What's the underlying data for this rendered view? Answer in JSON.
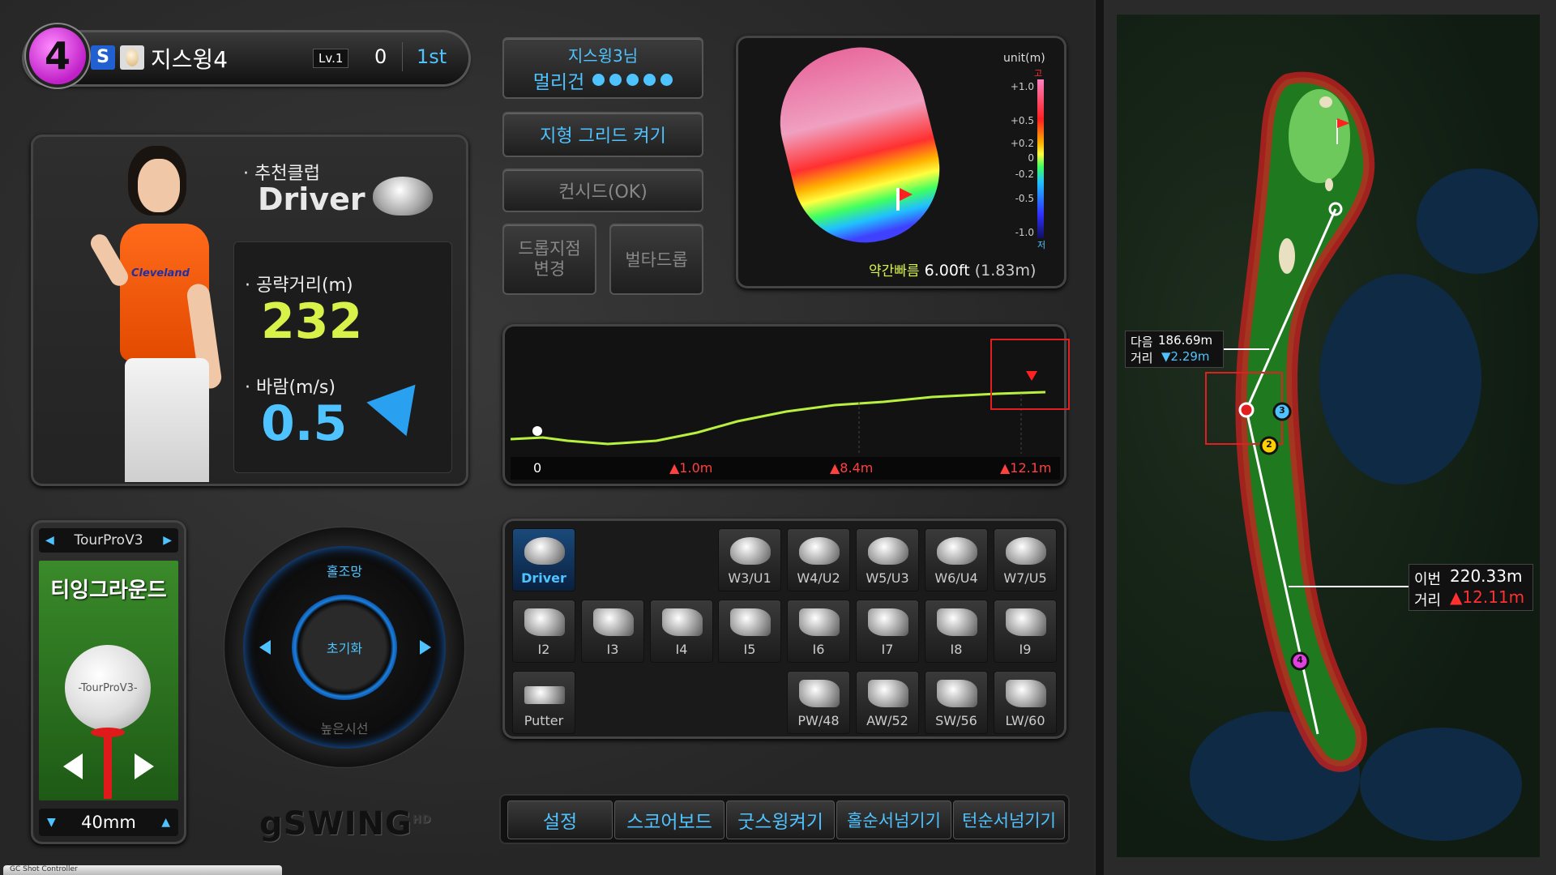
{
  "player": {
    "number": "4",
    "grade": "S",
    "name": "지스윙4",
    "level": "Lv.1",
    "score": "0",
    "rank": "1st"
  },
  "info": {
    "recommend_label": "· 추천클럽",
    "recommend_club": "Driver",
    "distance_label": "· 공략거리(m)",
    "distance_value": "232",
    "wind_label": "· 바람(m/s)",
    "wind_value": "0.5"
  },
  "top_buttons": {
    "player_line1": "지스윙3님",
    "player_line2": "멀리건",
    "terrain_grid": "지형 그리드 켜기",
    "concede": "컨시드(OK)",
    "drop_change": "드롭지점\n변경",
    "penalty_drop": "벌타드롭"
  },
  "green": {
    "unit": "unit(m)",
    "high": "고",
    "low": "저",
    "scale": [
      "+1.0",
      "+0.5",
      "+0.2",
      "0",
      "-0.2",
      "-0.5",
      "-1.0"
    ],
    "speed_label": "약간빠름",
    "speed_value": "6.00ft",
    "speed_meters": "(1.83m)"
  },
  "profile": {
    "ticks": [
      "0",
      "▲1.0m",
      "▲8.4m",
      "▲12.1m"
    ]
  },
  "ball_select": {
    "ball_name": "TourProV3",
    "ground": "티잉그라운드",
    "ball_print": "-TourProV3-",
    "tee_height": "40mm"
  },
  "dpad": {
    "up": "홀조망",
    "center": "초기화",
    "down": "높은시선"
  },
  "clubs": {
    "driver": "Driver",
    "woods": [
      "W3/U1",
      "W4/U2",
      "W5/U3",
      "W6/U4",
      "W7/U5"
    ],
    "irons": [
      "I2",
      "I3",
      "I4",
      "I5",
      "I6",
      "I7",
      "I8",
      "I9"
    ],
    "putter": "Putter",
    "wedges": [
      "PW/48",
      "AW/52",
      "SW/56",
      "LW/60"
    ]
  },
  "bottom_buttons": [
    "설정",
    "스코어보드",
    "굿스윙켜기",
    "홀순서넘기기",
    "턴순서넘기기"
  ],
  "logo": "gSWING",
  "logo_sup": "HD",
  "map": {
    "next_label1": "다음",
    "next_label2": "거리",
    "next_distance": "186.69m",
    "next_elev": "▼2.29m",
    "this_label1": "이번",
    "this_label2": "거리",
    "this_distance": "220.33m",
    "this_elev": "▲12.11m",
    "markers": [
      "3",
      "2",
      "4"
    ]
  },
  "taskbar": "GC Shot Controller",
  "colors": {
    "accent_blue": "#4fc3ff",
    "player_magenta": "#e040e0",
    "fairway_green": "#2e8b2e",
    "distance_yellow": "#d8f24a",
    "elev_red": "#ff3030"
  }
}
